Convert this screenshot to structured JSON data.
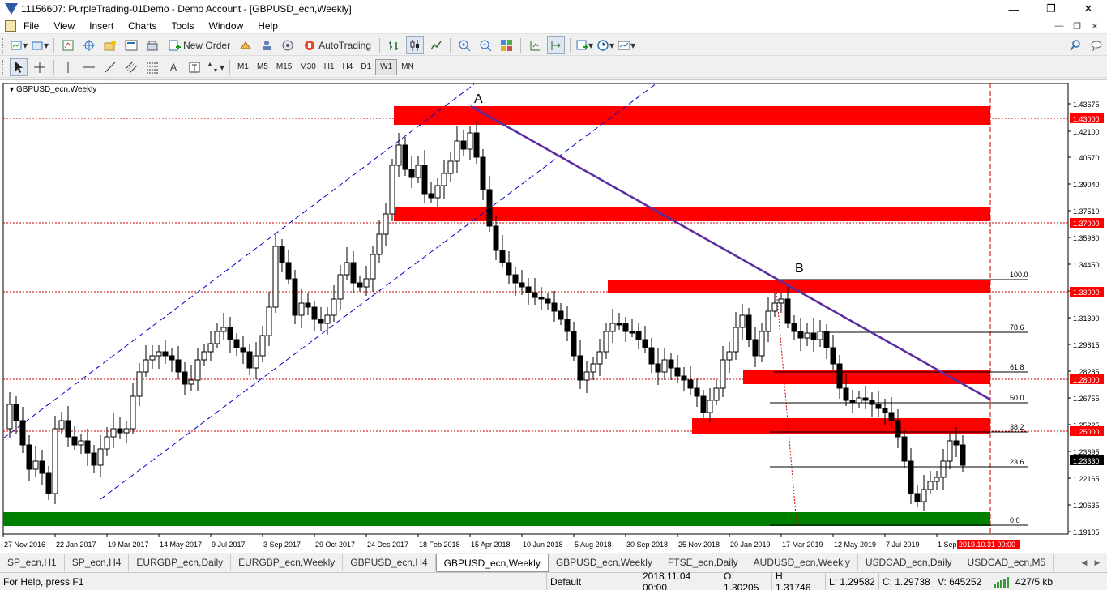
{
  "window": {
    "title": "11156607: PurpleTrading-01Demo - Demo Account - [GBPUSD_ecn,Weekly]",
    "minimize_icon": "minimize-icon",
    "restore_icon": "restore-icon",
    "close_icon": "close-icon"
  },
  "menu": [
    "File",
    "View",
    "Insert",
    "Charts",
    "Tools",
    "Window",
    "Help"
  ],
  "toolbar": {
    "new_order": "New Order",
    "autotrading": "AutoTrading"
  },
  "timeframes": [
    "M1",
    "M5",
    "M15",
    "M30",
    "H1",
    "H4",
    "D1",
    "W1",
    "MN"
  ],
  "active_timeframe": "W1",
  "chart": {
    "symbol_label": "GBPUSD_ecn,Weekly",
    "label_a": "A",
    "label_b": "B",
    "price_labels": [
      "1.43675",
      "1.42100",
      "1.40570",
      "1.39040",
      "1.37510",
      "1.35980",
      "1.34450",
      "1.32920",
      "1.31390",
      "1.29815",
      "1.28285",
      "1.26755",
      "1.25225",
      "1.23695",
      "1.22165",
      "1.20635",
      "1.19105"
    ],
    "level_labels": [
      "1.43000",
      "1.37000",
      "1.33000",
      "1.28000",
      "1.25000"
    ],
    "current_price": "1.23330",
    "fib_labels": [
      "100.0",
      "78.6",
      "61.8",
      "50.0",
      "38.2",
      "23.6",
      "0.0"
    ],
    "date_labels": [
      "27 Nov 2016",
      "22 Jan 2017",
      "19 Mar 2017",
      "14 May 2017",
      "9 Jul 2017",
      "3 Sep 2017",
      "29 Oct 2017",
      "24 Dec 2017",
      "18 Feb 2018",
      "15 Apr 2018",
      "10 Jun 2018",
      "5 Aug 2018",
      "30 Sep 2018",
      "25 Nov 2018",
      "20 Jan 2019",
      "17 Mar 2019",
      "12 May 2019",
      "7 Jul 2019",
      "1 Sep"
    ],
    "highlight_date": "2019.10.31 00:00",
    "colors": {
      "zone": "#ff0000",
      "support": "#008000",
      "trendline": "#5b2c9f",
      "channel": "#0000cc",
      "fib": "#000000",
      "levels": "#cc0000"
    }
  },
  "tabs": [
    "SP_ecn,H1",
    "SP_ecn,H4",
    "EURGBP_ecn,Daily",
    "EURGBP_ecn,Weekly",
    "GBPUSD_ecn,H4",
    "GBPUSD_ecn,Weekly",
    "GBPUSD_ecn,Weekly",
    "FTSE_ecn,Daily",
    "AUDUSD_ecn,Weekly",
    "USDCAD_ecn,Daily",
    "USDCAD_ecn,M5"
  ],
  "active_tab_index": 5,
  "status": {
    "help": "For Help, press F1",
    "profile": "Default",
    "datetime": "2018.11.04 00:00",
    "open": "O: 1.30205",
    "high": "H: 1.31746",
    "low": "L: 1.29582",
    "close": "C: 1.29738",
    "volume": "V: 645252",
    "traffic": "427/5 kb"
  }
}
